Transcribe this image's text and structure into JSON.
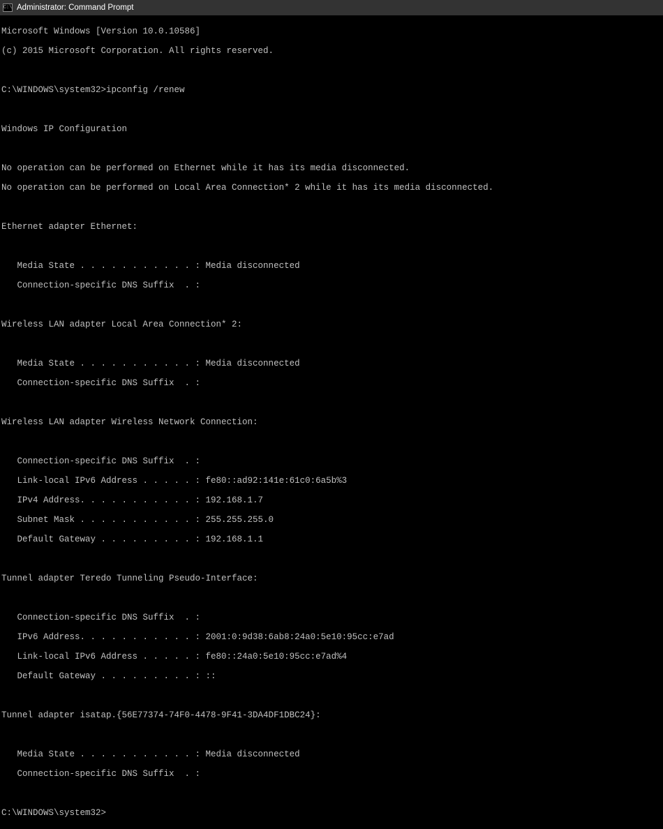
{
  "titlebar": {
    "icon_label": "cmd",
    "title": "Administrator: Command Prompt"
  },
  "lines": {
    "l0": "Microsoft Windows [Version 10.0.10586]",
    "l1": "(c) 2015 Microsoft Corporation. All rights reserved.",
    "l2": "",
    "l3": "C:\\WINDOWS\\system32>ipconfig /renew",
    "l4": "",
    "l5": "Windows IP Configuration",
    "l6": "",
    "l7": "No operation can be performed on Ethernet while it has its media disconnected.",
    "l8": "No operation can be performed on Local Area Connection* 2 while it has its media disconnected.",
    "l9": "",
    "l10": "Ethernet adapter Ethernet:",
    "l11": "",
    "l12": "   Media State . . . . . . . . . . . : Media disconnected",
    "l13": "   Connection-specific DNS Suffix  . :",
    "l14": "",
    "l15": "Wireless LAN adapter Local Area Connection* 2:",
    "l16": "",
    "l17": "   Media State . . . . . . . . . . . : Media disconnected",
    "l18": "   Connection-specific DNS Suffix  . :",
    "l19": "",
    "l20": "Wireless LAN adapter Wireless Network Connection:",
    "l21": "",
    "l22": "   Connection-specific DNS Suffix  . :",
    "l23": "   Link-local IPv6 Address . . . . . : fe80::ad92:141e:61c0:6a5b%3",
    "l24": "   IPv4 Address. . . . . . . . . . . : 192.168.1.7",
    "l25": "   Subnet Mask . . . . . . . . . . . : 255.255.255.0",
    "l26": "   Default Gateway . . . . . . . . . : 192.168.1.1",
    "l27": "",
    "l28": "Tunnel adapter Teredo Tunneling Pseudo-Interface:",
    "l29": "",
    "l30": "   Connection-specific DNS Suffix  . :",
    "l31": "   IPv6 Address. . . . . . . . . . . : 2001:0:9d38:6ab8:24a0:5e10:95cc:e7ad",
    "l32": "   Link-local IPv6 Address . . . . . : fe80::24a0:5e10:95cc:e7ad%4",
    "l33": "   Default Gateway . . . . . . . . . : ::",
    "l34": "",
    "l35": "Tunnel adapter isatap.{56E77374-74F0-4478-9F41-3DA4DF1DBC24}:",
    "l36": "",
    "l37": "   Media State . . . . . . . . . . . : Media disconnected",
    "l38": "   Connection-specific DNS Suffix  . :",
    "l39": "",
    "l40": "C:\\WINDOWS\\system32>"
  }
}
